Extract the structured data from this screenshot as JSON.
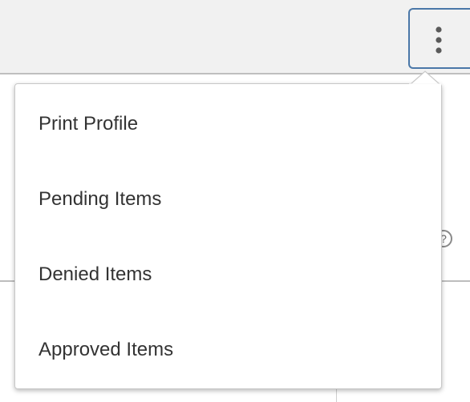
{
  "toolbar": {
    "more_button_label": "More actions",
    "more_icon": "vertical-ellipsis-icon"
  },
  "background": {
    "help_icon": "help-icon",
    "help_glyph": "?"
  },
  "menu": {
    "items": [
      {
        "label": "Print Profile"
      },
      {
        "label": "Pending Items"
      },
      {
        "label": "Denied Items"
      },
      {
        "label": "Approved Items"
      }
    ]
  },
  "colors": {
    "accent_border": "#4a77a8",
    "menu_text": "#333333",
    "header_bg": "#f1f1f1"
  }
}
